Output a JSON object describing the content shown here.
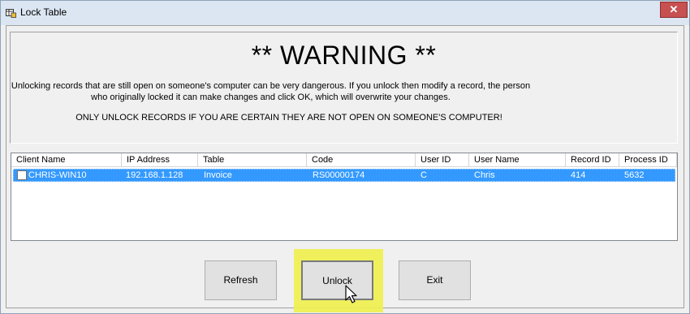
{
  "window": {
    "title": "Lock Table",
    "close_label": "✕"
  },
  "warning": {
    "title": "** WARNING **",
    "line1": "Unlocking records that are still open on someone's computer can be very dangerous.  If you unlock then modify a record, the person",
    "line2": "who originally locked it can make changes and click OK, which will overwrite your changes.",
    "line3": "ONLY UNLOCK RECORDS IF YOU ARE CERTAIN THEY ARE NOT OPEN ON SOMEONE'S COMPUTER!"
  },
  "grid": {
    "columns": [
      "Client Name",
      "IP Address",
      "Table",
      "Code",
      "User ID",
      "User Name",
      "Record ID",
      "Process ID"
    ],
    "rows": [
      {
        "checked": false,
        "selected": true,
        "cells": [
          "CHRIS-WIN10",
          "192.168.1.128",
          "Invoice",
          "RS00000174",
          "C",
          "Chris",
          "414",
          "5632"
        ]
      }
    ]
  },
  "buttons": {
    "refresh": "Refresh",
    "unlock": "Unlock",
    "exit": "Exit"
  },
  "colors": {
    "selection": "#3399ff",
    "highlight": "#eef04a",
    "close_button": "#c75050"
  },
  "icons": {
    "app": "table-app-icon",
    "cursor": "mouse-pointer-icon"
  }
}
